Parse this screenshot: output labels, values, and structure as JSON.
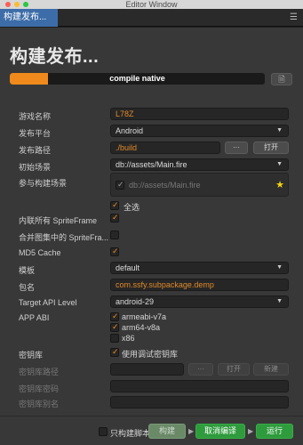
{
  "window": {
    "title": "Editor Window"
  },
  "tab": {
    "label": "构建发布..."
  },
  "panel": {
    "title": "构建发布..."
  },
  "progress": {
    "label": "compile native",
    "fraction": 0.15
  },
  "fields": {
    "game_name": {
      "label": "游戏名称",
      "value": "L78Z"
    },
    "platform": {
      "label": "发布平台",
      "value": "Android"
    },
    "build_path": {
      "label": "发布路径",
      "value": "./build",
      "browse": "···",
      "open": "打开"
    },
    "start_scene": {
      "label": "初始场景",
      "value": "db://assets/Main.fire"
    },
    "included_scenes": {
      "label": "参与构建场景",
      "scene": "db://assets/Main.fire",
      "select_all": "全选"
    },
    "inline_spriteframe": {
      "label": "内联所有 SpriteFrame",
      "checked": true
    },
    "merge_spriteframe": {
      "label": "合并图集中的 SpriteFra...",
      "checked": false
    },
    "md5_cache": {
      "label": "MD5 Cache",
      "checked": true
    },
    "template": {
      "label": "模板",
      "value": "default"
    },
    "package_name": {
      "label": "包名",
      "value": "com.ssfy.subpackage.demp"
    },
    "target_api": {
      "label": "Target API Level",
      "value": "android-29"
    },
    "app_abi": {
      "label": "APP ABI",
      "options": [
        {
          "label": "armeabi-v7a",
          "checked": true
        },
        {
          "label": "arm64-v8a",
          "checked": true
        },
        {
          "label": "x86",
          "checked": false
        }
      ]
    },
    "keystore": {
      "label": "密钥库",
      "option": "使用调试密钥库",
      "checked": true
    },
    "keystore_path": {
      "label": "密钥库路径",
      "browse": "···",
      "open": "打开",
      "new": "新建"
    },
    "keystore_password": {
      "label": "密钥库密码"
    },
    "keystore_alias": {
      "label": "密钥库别名"
    }
  },
  "footer": {
    "build_script_only": "只构建脚本",
    "build": "构建",
    "cancel_compile": "取消编译",
    "run": "运行"
  },
  "colors": {
    "accent": "#f08a1c",
    "tab": "#3d6da8",
    "green": "#2e9b3c"
  }
}
